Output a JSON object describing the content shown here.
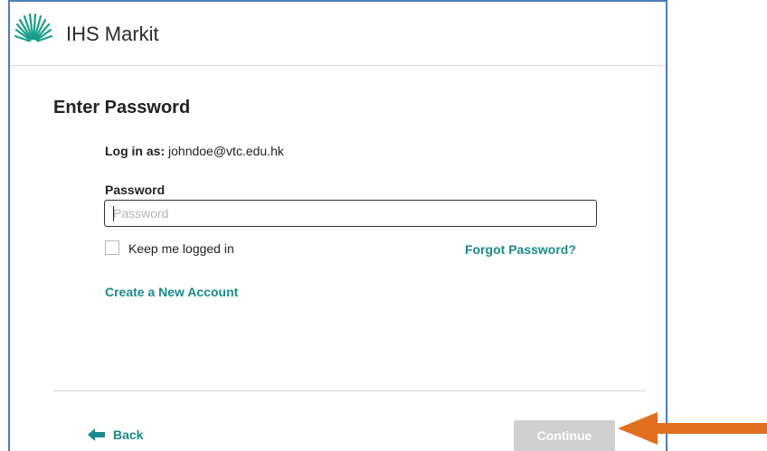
{
  "header": {
    "brand": "IHS Markit",
    "logo_icon": "ihs-markit-logo-icon"
  },
  "form": {
    "title": "Enter Password",
    "login_as_label": "Log in as:",
    "login_as_email": "johndoe@vtc.edu.hk",
    "password_label": "Password",
    "password_placeholder": "Password",
    "password_value": "",
    "keep_logged_in_label": "Keep me logged in",
    "keep_logged_in_checked": false,
    "forgot_password": "Forgot Password?",
    "create_account": "Create a New Account"
  },
  "footer": {
    "back_label": "Back",
    "continue_label": "Continue",
    "continue_enabled": false
  },
  "colors": {
    "link": "#1b8a8a",
    "frame_border": "#4a7ebb",
    "annotation_arrow": "#e07020",
    "continue_disabled": "#d0d0d0"
  }
}
